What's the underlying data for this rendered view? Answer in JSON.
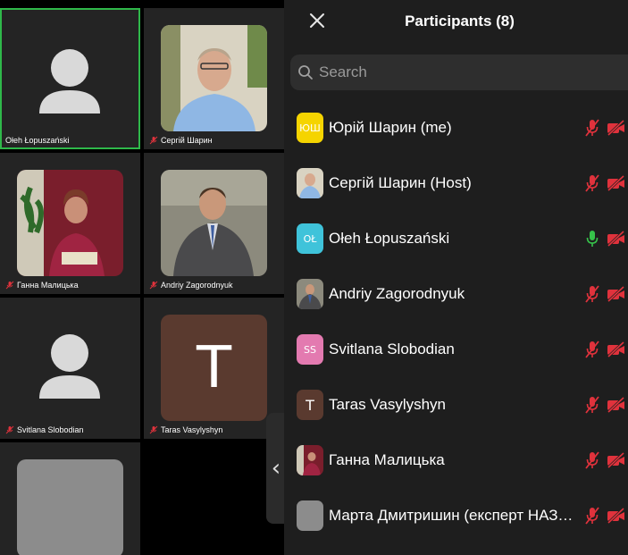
{
  "panel": {
    "title": "Participants (8)",
    "search_placeholder": "Search"
  },
  "tiles": [
    {
      "name": "Ołeh Łopuszański",
      "avatar": "silhouette",
      "muted": false,
      "active": true
    },
    {
      "name": "Сергій Шарин",
      "avatar": "photo-man-shirt",
      "muted": true,
      "active": false
    },
    {
      "name": "Ганна Малицька",
      "avatar": "photo-woman-plant",
      "muted": true,
      "active": false
    },
    {
      "name": "Andriy Zagorodnyuk",
      "avatar": "photo-man-suit",
      "muted": true,
      "active": false
    },
    {
      "name": "Svitlana Slobodian",
      "avatar": "silhouette",
      "muted": true,
      "active": false
    },
    {
      "name": "Taras Vasylyshyn",
      "avatar_letter": "T",
      "muted": true,
      "active": false
    },
    {
      "name": "",
      "avatar": "grey",
      "muted": false,
      "active": false
    }
  ],
  "participants": [
    {
      "name": "Юрій Шарин (me)",
      "initials": "ЮШ",
      "avatar_color": "#f5d400",
      "initials_color": "#ffffff",
      "mic": "muted",
      "camera": "off"
    },
    {
      "name": "Сергій Шарин (Host)",
      "avatar": "photo-man-shirt",
      "mic": "muted",
      "camera": "off"
    },
    {
      "name": "Ołeh Łopuszański",
      "initials": "OŁ",
      "avatar_color": "#3fc3da",
      "initials_color": "#ffffff",
      "mic": "on",
      "camera": "off"
    },
    {
      "name": "Andriy Zagorodnyuk",
      "avatar": "photo-man-suit",
      "mic": "muted",
      "camera": "off"
    },
    {
      "name": "Svitlana Slobodian",
      "initials": "SS",
      "avatar_color": "#e37ab0",
      "initials_color": "#ffffff",
      "mic": "muted",
      "camera": "off"
    },
    {
      "name": "Taras Vasylyshyn",
      "initials": "T",
      "avatar_color": "#5a3a2f",
      "initials_color": "#ffffff",
      "mic": "muted",
      "camera": "off"
    },
    {
      "name": "Ганна Малицька",
      "avatar": "photo-woman-plant",
      "mic": "muted",
      "camera": "off"
    },
    {
      "name": "Марта Дмитришин (експерт НАЗЯВО)",
      "avatar_color": "#8c8c8c",
      "mic": "muted",
      "camera": "off"
    }
  ],
  "colors": {
    "muted_red": "#e0323c",
    "mic_on_green": "#36c24a",
    "active_speaker_border": "#2fb84a",
    "panel_bg": "#1e1e1e",
    "tile_bg": "#242424"
  },
  "icons": {
    "close": "close-icon",
    "search": "search-icon",
    "collapse": "chevron-left-icon",
    "mic_muted": "mic-muted-icon",
    "mic_on": "mic-icon",
    "camera_off": "video-off-icon"
  }
}
